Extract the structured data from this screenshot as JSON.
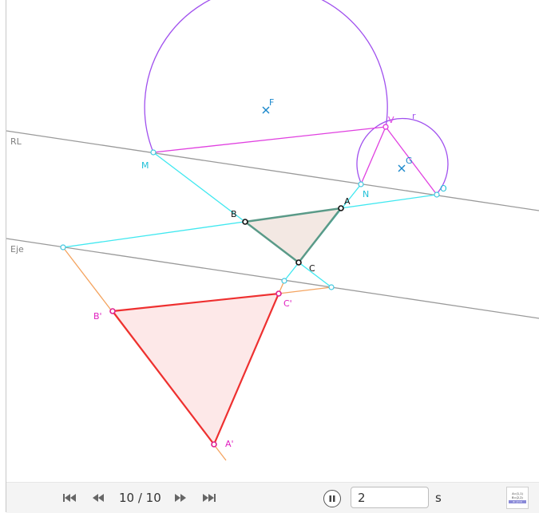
{
  "colors": {
    "magenta": "#e040e0",
    "violet": "#a050ee",
    "cyan": "#40e8f0",
    "orange": "#f4a460",
    "gray": "#9a9a9a",
    "red": "#ee3030",
    "blue_point": "#1a88cc",
    "triangle_fill": "#f2e6e0",
    "triangle_stroke": "#5a9a88",
    "image_fill": "#fde4e4"
  },
  "lines": {
    "rl_label": "RL",
    "eje_label": "Eje"
  },
  "points": {
    "A": "A",
    "B": "B",
    "C": "C",
    "A_prime": "A'",
    "B_prime": "B'",
    "C_prime": "C'",
    "M": "M",
    "N": "N",
    "O": "O",
    "V": "V",
    "F": "F",
    "G": "G",
    "r": "r"
  },
  "toolbar": {
    "step_counter": "10 / 10",
    "speed_value": "2",
    "speed_unit": "s",
    "algebra_lines": [
      "A=(1,1)",
      "B=(2,2)",
      "a: y=x"
    ]
  },
  "icons": {
    "first": "skip-to-start-icon",
    "prev": "step-back-icon",
    "next": "step-forward-icon",
    "last": "skip-to-end-icon",
    "pause": "pause-icon",
    "algebra": "algebra-view-icon"
  }
}
